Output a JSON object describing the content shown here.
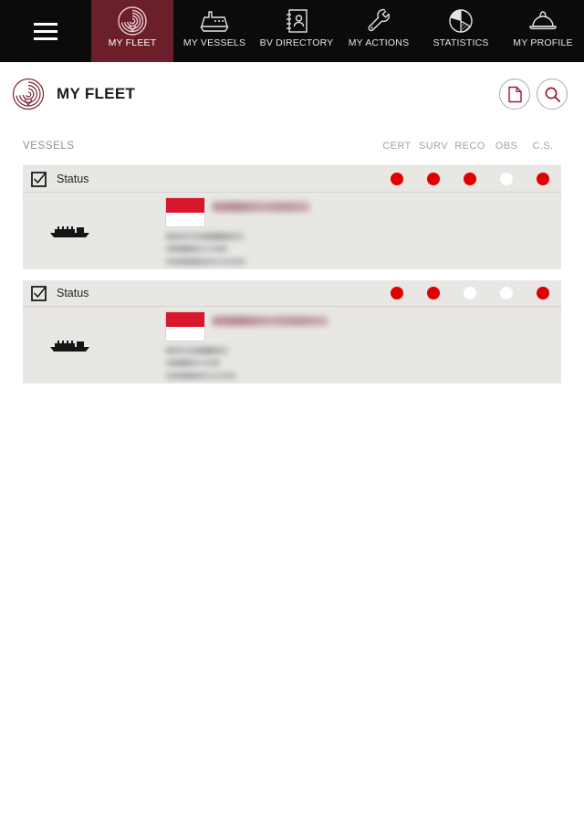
{
  "colors": {
    "brand_maroon": "#6b1f2a",
    "nav_background": "#0b0b0b",
    "card_background": "#e9e7e4",
    "status_red": "#e00000",
    "status_white": "#ffffff",
    "flag_red": "#d8172c",
    "page_background": "#ffffff"
  },
  "top_nav": {
    "menu_icon": "hamburger-menu-icon",
    "items": [
      {
        "label": "MY FLEET",
        "icon": "fingerprint-spiral-icon",
        "active": true
      },
      {
        "label": "MY VESSELS",
        "icon": "ship-icon",
        "active": false
      },
      {
        "label": "BV DIRECTORY",
        "icon": "contact-book-icon",
        "active": false
      },
      {
        "label": "MY ACTIONS",
        "icon": "wrench-icon",
        "active": false
      },
      {
        "label": "STATISTICS",
        "icon": "pie-chart-icon",
        "active": false
      },
      {
        "label": "MY PROFILE",
        "icon": "hard-hat-icon",
        "active": false
      }
    ]
  },
  "header": {
    "logo_icon": "fingerprint-spiral-icon",
    "title": "MY FLEET",
    "actions": [
      {
        "icon": "document-icon",
        "name": "document-button"
      },
      {
        "icon": "search-icon",
        "name": "search-button"
      }
    ]
  },
  "list_header": {
    "vessels_label": "VESSELS",
    "columns": [
      "CERT",
      "SURV",
      "RECO",
      "OBS",
      "C.S."
    ]
  },
  "fleet": {
    "cards": [
      {
        "checkbox_checked": true,
        "status_label": "Status",
        "statuses": [
          "red",
          "red",
          "red",
          "white",
          "red"
        ],
        "ship_icon": "cargo-ship-icon",
        "flag": "red-white-horizontal-flag",
        "name_redacted": true,
        "redacted_widths": {
          "name": 108,
          "line2": 88,
          "line3": 68,
          "line4": 88
        }
      },
      {
        "checkbox_checked": true,
        "status_label": "Status",
        "statuses": [
          "red",
          "red",
          "white",
          "white",
          "red"
        ],
        "ship_icon": "cargo-ship-icon",
        "flag": "red-white-horizontal-flag",
        "name_redacted": true,
        "redacted_widths": {
          "name": 128,
          "line2": 70,
          "line3": 60,
          "line4": 78
        }
      }
    ]
  }
}
